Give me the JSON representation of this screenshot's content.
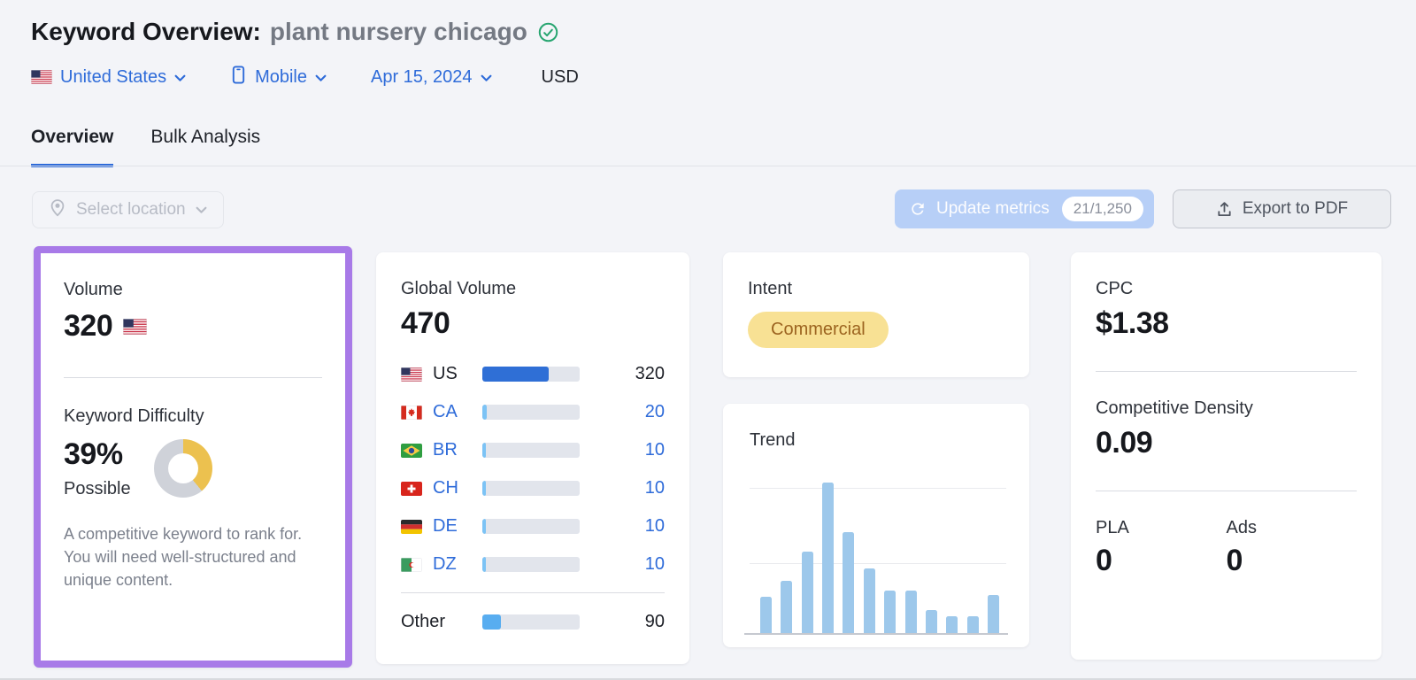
{
  "header": {
    "title": "Keyword Overview:",
    "keyword": "plant nursery chicago",
    "verified_icon": "check-circle-icon",
    "filters": {
      "country": "United States",
      "country_flag": "US",
      "device": "Mobile",
      "date": "Apr 15, 2024",
      "currency": "USD"
    }
  },
  "tabs": [
    {
      "label": "Overview",
      "active": true
    },
    {
      "label": "Bulk Analysis",
      "active": false
    }
  ],
  "toolbar": {
    "select_location": "Select location",
    "update_metrics": "Update metrics",
    "update_quota": "21/1,250",
    "export_pdf": "Export to PDF"
  },
  "cards": {
    "volume": {
      "label": "Volume",
      "value": "320",
      "flag": "US"
    },
    "keyword_difficulty": {
      "label": "Keyword Difficulty",
      "percent": "39%",
      "percent_value": 39,
      "rating": "Possible",
      "description": "A competitive keyword to rank for. You will need well-structured and unique content."
    },
    "global_volume": {
      "label": "Global Volume",
      "value": "470",
      "countries": [
        {
          "code": "US",
          "value": "320",
          "share": 0.68,
          "current": true
        },
        {
          "code": "CA",
          "value": "20",
          "share": 0.045
        },
        {
          "code": "BR",
          "value": "10",
          "share": 0.021
        },
        {
          "code": "CH",
          "value": "10",
          "share": 0.021
        },
        {
          "code": "DE",
          "value": "10",
          "share": 0.021
        },
        {
          "code": "DZ",
          "value": "10",
          "share": 0.021
        }
      ],
      "other": {
        "label": "Other",
        "value": "90",
        "share": 0.19
      }
    },
    "intent": {
      "label": "Intent",
      "badge": "Commercial"
    },
    "trend": {
      "label": "Trend"
    },
    "cpc": {
      "label": "CPC",
      "value": "$1.38"
    },
    "competitive_density": {
      "label": "Competitive Density",
      "value": "0.09"
    },
    "pla": {
      "label": "PLA",
      "value": "0"
    },
    "ads": {
      "label": "Ads",
      "value": "0"
    }
  },
  "colors": {
    "accent_blue": "#2e6bd9",
    "highlight_purple": "#a87ae8",
    "kd_yellow": "#ecc14f",
    "kd_gray": "#cfd2d9",
    "trend_bar_blue": "#9dc8eb",
    "us_bar_blue": "#2f6fd6",
    "minor_bar_blue": "#7cc3f5",
    "other_bar_blue": "#58adf0",
    "intent_badge_bg": "#f8e194",
    "intent_badge_text": "#9c6420",
    "verified_green": "#27a570",
    "update_btn_bg": "#b7cff7"
  },
  "chart_data": [
    {
      "id": "trend",
      "type": "bar",
      "title": "Trend",
      "categories": null,
      "xticks_visible": false,
      "yticks_visible": false,
      "grid": "two horizontal gridlines",
      "values_unit": "percent of max (12 monthly bars, unlabeled axes)",
      "values": [
        24,
        35,
        54,
        100,
        67,
        43,
        28,
        28,
        15,
        11,
        11,
        25
      ]
    },
    {
      "id": "global_volume_split",
      "type": "bar",
      "orientation": "horizontal",
      "title": "Global Volume 470",
      "categories": [
        "US",
        "CA",
        "BR",
        "CH",
        "DE",
        "DZ",
        "Other"
      ],
      "values": [
        320,
        20,
        10,
        10,
        10,
        10,
        90
      ]
    },
    {
      "id": "keyword_difficulty_donut",
      "type": "pie",
      "title": "Keyword Difficulty",
      "categories": [
        "difficulty",
        "remainder"
      ],
      "values": [
        39,
        61
      ]
    }
  ]
}
